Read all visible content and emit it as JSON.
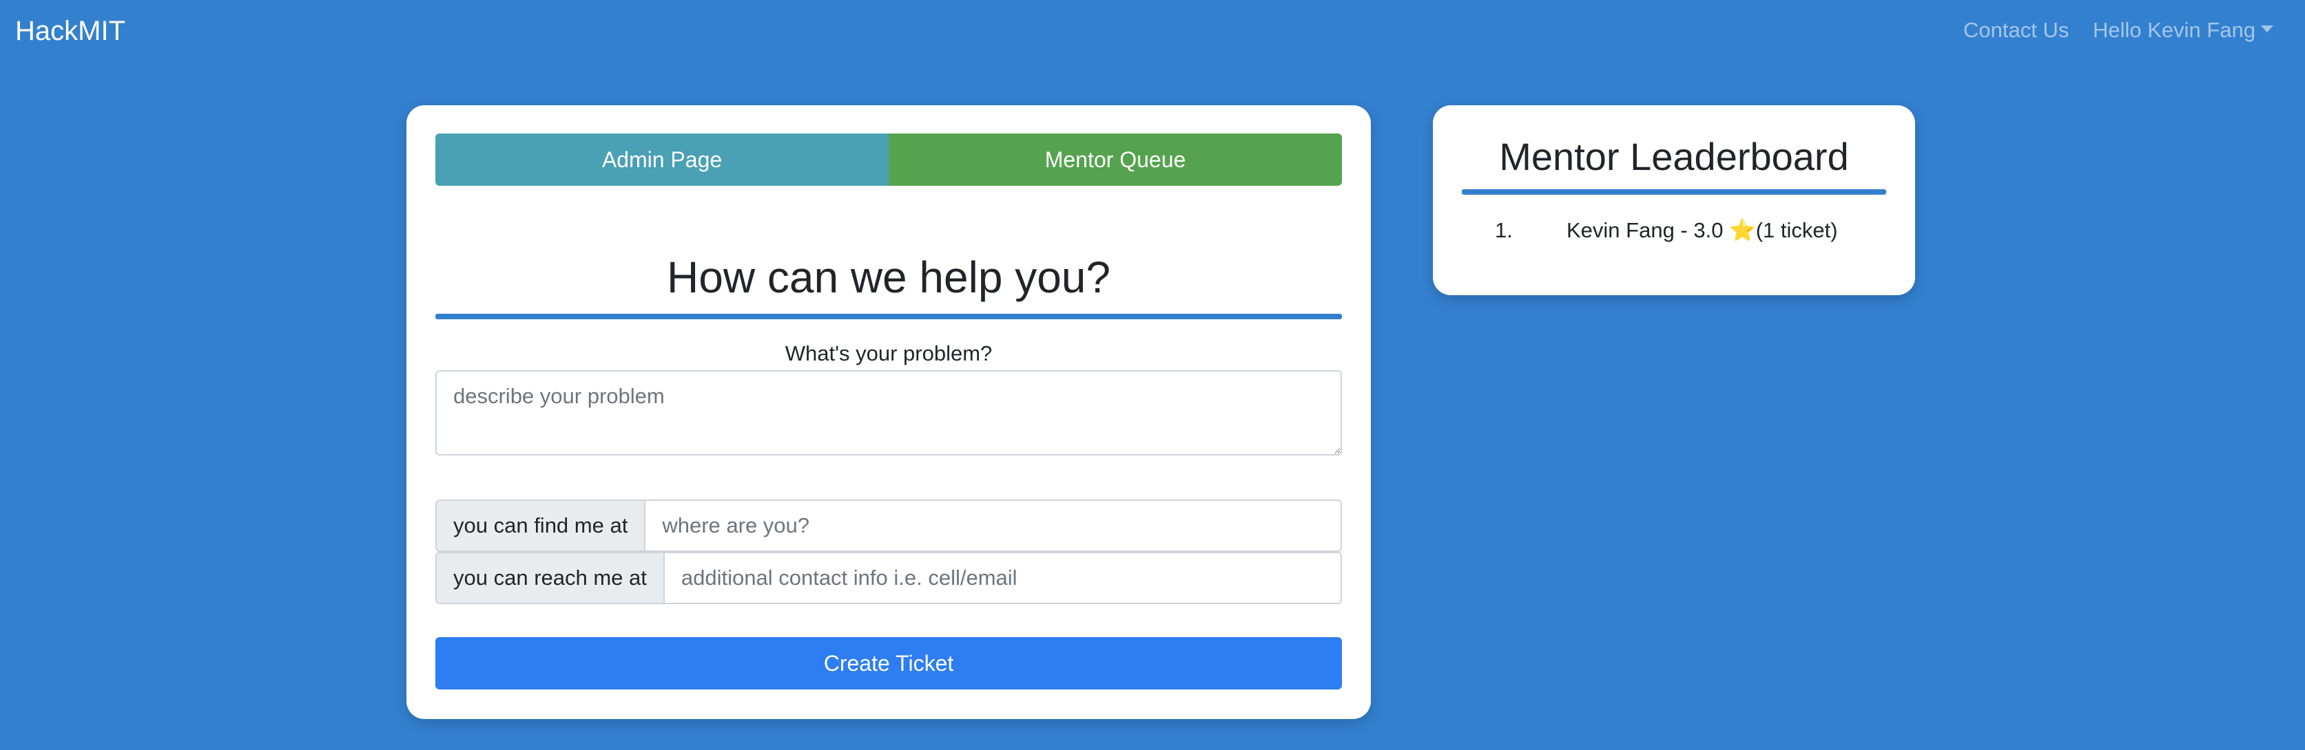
{
  "navbar": {
    "brand": "HackMIT",
    "contact": "Contact Us",
    "user": "Hello Kevin Fang"
  },
  "tabs": {
    "admin": "Admin Page",
    "mentor": "Mentor Queue"
  },
  "form": {
    "heading": "How can we help you?",
    "problem_label": "What's your problem?",
    "problem_placeholder": "describe your problem",
    "location_addon": "you can find me at",
    "location_placeholder": "where are you?",
    "contact_addon": "you can reach me at",
    "contact_placeholder": "additional contact info i.e. cell/email",
    "submit": "Create Ticket"
  },
  "leaderboard": {
    "title": "Mentor Leaderboard",
    "entries": [
      {
        "rank": "1.",
        "text": "Kevin Fang - 3.0",
        "star": "⭐",
        "tickets": "(1 ticket)"
      }
    ]
  },
  "colors": {
    "background": "#3380cf",
    "admin_button": "#4aa0b5",
    "mentor_button": "#55a34f",
    "create_button": "#2e7df2"
  }
}
